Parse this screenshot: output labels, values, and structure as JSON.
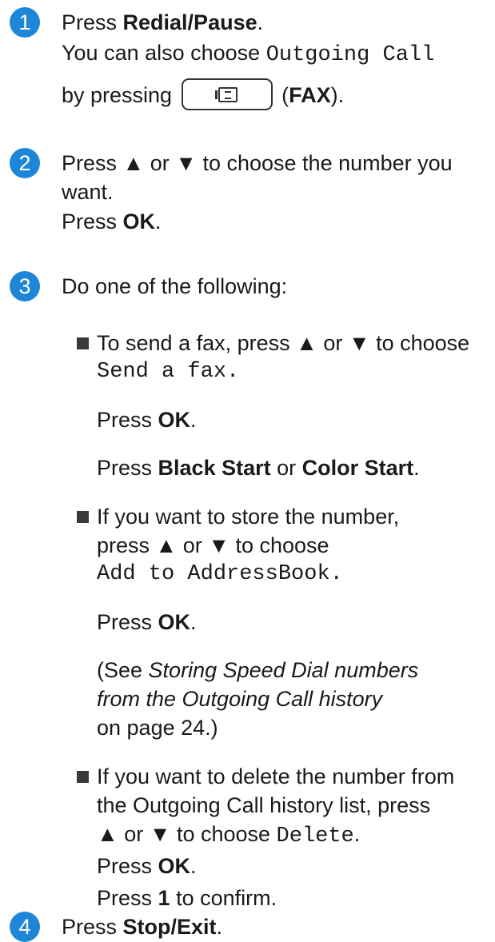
{
  "step1": {
    "number": "1",
    "press": "Press ",
    "redial": "Redial/Pause",
    "period": ".",
    "also": "You can also choose ",
    "outgoing_call": "Outgoing Call",
    "by_pressing": "by pressing",
    "paren_open": " (",
    "fax": "FAX",
    "paren_close": ")."
  },
  "step2": {
    "number": "2",
    "line1": "Press ▲ or ▼ to choose the number you",
    "line2": "want.",
    "press": "Press ",
    "ok": "OK",
    "period": "."
  },
  "step3": {
    "number": "3",
    "intro": "Do one of the following:",
    "b1": {
      "line1": "To send a fax, press ▲ or ▼ to choose",
      "option": "Send a fax",
      "press": "Press ",
      "ok": "OK",
      "black_start": "Black Start",
      "or": " or ",
      "color_start": "Color Start"
    },
    "b2": {
      "line1": "If you want to store the number,",
      "line2": "press ▲ or ▼ to choose",
      "option": "Add to AddressBook",
      "press": "Press ",
      "ok": "OK",
      "see": "(See ",
      "link1": "Storing Speed Dial numbers",
      "link2": "from the Outgoing Call history",
      "page": "on page 24.)"
    },
    "b3": {
      "line1": "If you want to delete the number from",
      "line2": "the Outgoing Call history list, press",
      "line3": "▲ or ▼ to choose ",
      "option": "Delete",
      "press": "Press ",
      "ok": "OK",
      "one": "1",
      "confirm": " to confirm."
    }
  },
  "step4": {
    "number": "4",
    "press": "Press ",
    "stop": "Stop/Exit",
    "period": "."
  },
  "dot": "."
}
